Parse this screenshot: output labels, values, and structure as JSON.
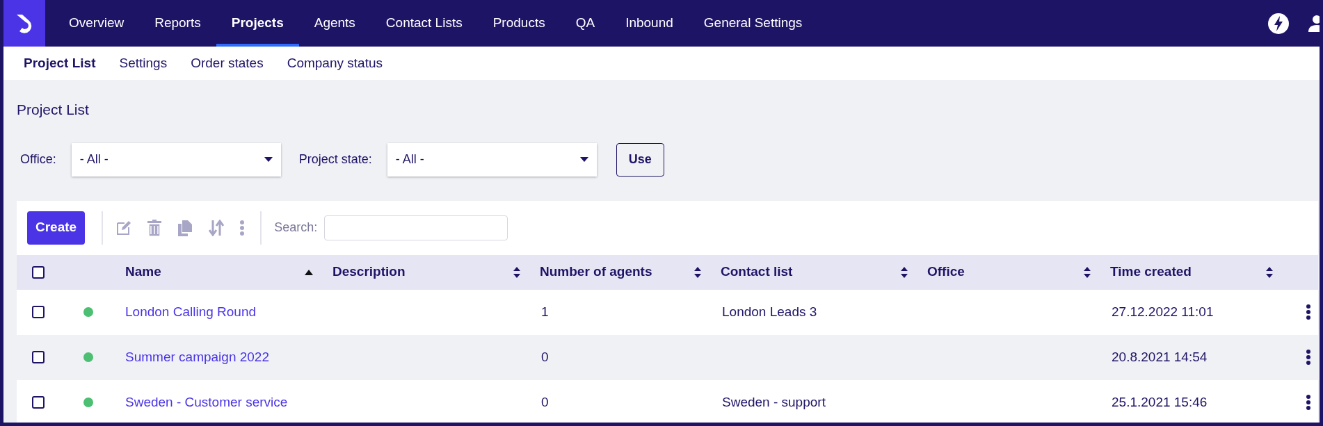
{
  "nav": {
    "items": [
      {
        "label": "Overview",
        "selected": false
      },
      {
        "label": "Reports",
        "selected": false
      },
      {
        "label": "Projects",
        "selected": true
      },
      {
        "label": "Agents",
        "selected": false
      },
      {
        "label": "Contact Lists",
        "selected": false
      },
      {
        "label": "Products",
        "selected": false
      },
      {
        "label": "QA",
        "selected": false
      },
      {
        "label": "Inbound",
        "selected": false
      },
      {
        "label": "General Settings",
        "selected": false
      }
    ]
  },
  "subnav": {
    "items": [
      {
        "label": "Project List",
        "selected": true
      },
      {
        "label": "Settings",
        "selected": false
      },
      {
        "label": "Order states",
        "selected": false
      },
      {
        "label": "Company status",
        "selected": false
      }
    ]
  },
  "page_title": "Project List",
  "filters": [
    {
      "label": "Office:",
      "value": "- All -"
    },
    {
      "label": "Project state:",
      "value": "- All -"
    }
  ],
  "use_button": "Use",
  "toolbar": {
    "create_button": "Create",
    "search_label": "Search:"
  },
  "table": {
    "select_all": {
      "checked": false
    },
    "columns": [
      {
        "label": "Name",
        "sorted": true
      },
      {
        "label": "Description",
        "sorted": false
      },
      {
        "label": "Number of agents",
        "sorted": false
      },
      {
        "label": "Contact list",
        "sorted": false
      },
      {
        "label": "Office",
        "sorted": false
      },
      {
        "label": "Time created",
        "sorted": false
      }
    ],
    "rows": [
      {
        "checked": false,
        "color": "#4cbf73",
        "cells": [
          "London Calling Round",
          null,
          "1",
          "London Leads 3",
          null,
          "27.12.2022 11:01"
        ]
      },
      {
        "checked": false,
        "color": "#4cbf73",
        "cells": [
          "Summer campaign 2022",
          null,
          "0",
          null,
          null,
          "20.8.2021 14:54"
        ]
      },
      {
        "checked": false,
        "color": "#4cbf73",
        "cells": [
          "Sweden - Customer service",
          null,
          "0",
          "Sweden - support",
          null,
          "25.1.2021 15:46"
        ]
      }
    ]
  }
}
